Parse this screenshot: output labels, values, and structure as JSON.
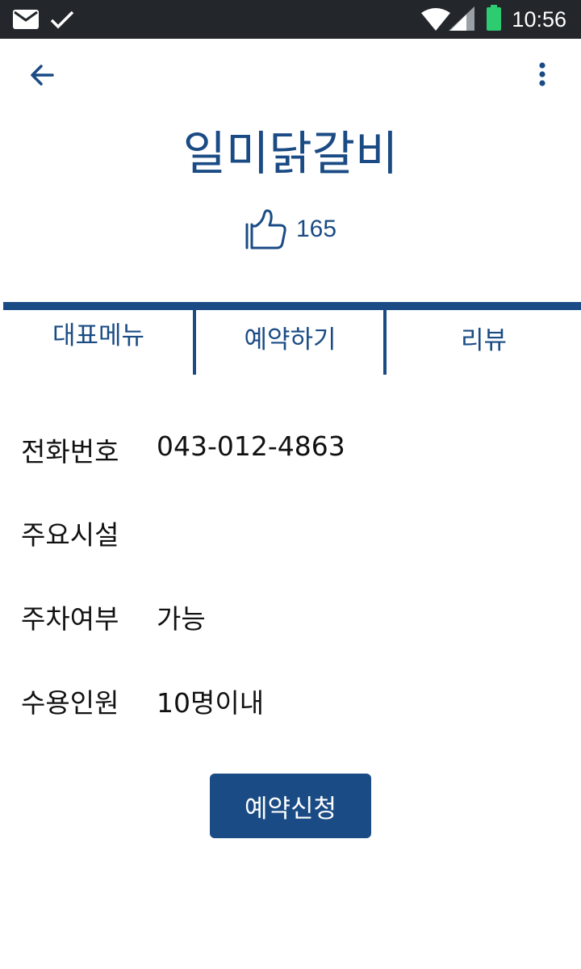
{
  "status_bar": {
    "time": "10:56",
    "icons": [
      "mail-icon",
      "check-icon",
      "wifi-icon",
      "cell-signal-icon",
      "battery-icon"
    ],
    "battery_color": "#2ecc71"
  },
  "app_bar": {
    "back_icon": "arrow-left-icon",
    "menu_icon": "more-vert-icon"
  },
  "restaurant": {
    "name": "일미닭갈비",
    "like_icon": "thumbs-up-icon",
    "likes": "165"
  },
  "tabs": [
    {
      "label": "대표메뉴"
    },
    {
      "label": "예약하기"
    },
    {
      "label": "리뷰"
    }
  ],
  "info": [
    {
      "label": "전화번호",
      "value": "043-012-4863"
    },
    {
      "label": "주요시설",
      "value": ""
    },
    {
      "label": "주차여부",
      "value": "가능"
    },
    {
      "label": "수용인원",
      "value": "10명이내"
    }
  ],
  "reserve_button": {
    "label": "예약신청"
  },
  "colors": {
    "accent": "#1a4b84",
    "status_bar": "#23272b"
  }
}
